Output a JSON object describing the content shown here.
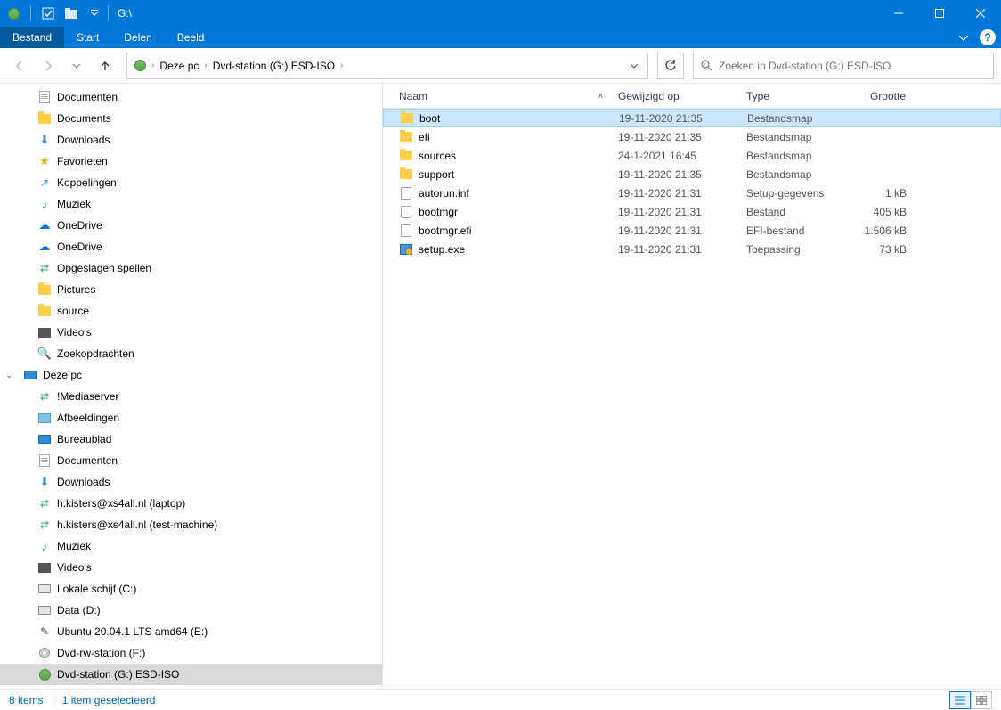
{
  "titlebar": {
    "title": "G:\\"
  },
  "ribbon": {
    "file": "Bestand",
    "tabs": [
      "Start",
      "Delen",
      "Beeld"
    ]
  },
  "breadcrumb": {
    "items": [
      "Deze pc",
      "Dvd-station (G:) ESD-ISO"
    ]
  },
  "search": {
    "placeholder": "Zoeken in Dvd-station (G:) ESD-ISO"
  },
  "columns": {
    "name": "Naam",
    "modified": "Gewijzigd op",
    "type": "Type",
    "size": "Grootte"
  },
  "nav_groups": [
    {
      "indent": 1,
      "icon": "doc",
      "label": "Documenten"
    },
    {
      "indent": 1,
      "icon": "folder",
      "label": "Documents"
    },
    {
      "indent": 1,
      "icon": "down",
      "label": "Downloads"
    },
    {
      "indent": 1,
      "icon": "star",
      "label": "Favorieten"
    },
    {
      "indent": 1,
      "icon": "link",
      "label": "Koppelingen"
    },
    {
      "indent": 1,
      "icon": "music",
      "label": "Muziek"
    },
    {
      "indent": 1,
      "icon": "cloud",
      "label": "OneDrive"
    },
    {
      "indent": 1,
      "icon": "cloud",
      "label": "OneDrive"
    },
    {
      "indent": 1,
      "icon": "net",
      "label": "Opgeslagen spellen"
    },
    {
      "indent": 1,
      "icon": "folder",
      "label": "Pictures"
    },
    {
      "indent": 1,
      "icon": "folder",
      "label": "source"
    },
    {
      "indent": 1,
      "icon": "vid",
      "label": "Video's"
    },
    {
      "indent": 1,
      "icon": "search",
      "label": "Zoekopdrachten"
    }
  ],
  "nav_thispc": {
    "root": "Deze pc",
    "items": [
      {
        "icon": "net",
        "label": "!Mediaserver"
      },
      {
        "icon": "pic",
        "label": "Afbeeldingen"
      },
      {
        "icon": "monitor",
        "label": "Bureaublad"
      },
      {
        "icon": "doc",
        "label": "Documenten"
      },
      {
        "icon": "down",
        "label": "Downloads"
      },
      {
        "icon": "net",
        "label": "h.kisters@xs4all.nl (laptop)"
      },
      {
        "icon": "net",
        "label": "h.kisters@xs4all.nl (test-machine)"
      },
      {
        "icon": "music",
        "label": "Muziek"
      },
      {
        "icon": "vid",
        "label": "Video's"
      },
      {
        "icon": "drive",
        "label": "Lokale schijf (C:)"
      },
      {
        "icon": "drive",
        "label": "Data (D:)"
      },
      {
        "icon": "usb",
        "label": "Ubuntu 20.04.1 LTS amd64 (E:)"
      },
      {
        "icon": "disc",
        "label": "Dvd-rw-station (F:)"
      },
      {
        "icon": "disc2",
        "label": "Dvd-station (G:) ESD-ISO",
        "selected": true
      }
    ]
  },
  "files": [
    {
      "icon": "folder",
      "name": "boot",
      "modified": "19-11-2020 21:35",
      "type": "Bestandsmap",
      "size": "",
      "selected": true
    },
    {
      "icon": "folder",
      "name": "efi",
      "modified": "19-11-2020 21:35",
      "type": "Bestandsmap",
      "size": ""
    },
    {
      "icon": "folder",
      "name": "sources",
      "modified": "24-1-2021 16:45",
      "type": "Bestandsmap",
      "size": ""
    },
    {
      "icon": "folder",
      "name": "support",
      "modified": "19-11-2020 21:35",
      "type": "Bestandsmap",
      "size": ""
    },
    {
      "icon": "file",
      "name": "autorun.inf",
      "modified": "19-11-2020 21:31",
      "type": "Setup-gegevens",
      "size": "1 kB"
    },
    {
      "icon": "file",
      "name": "bootmgr",
      "modified": "19-11-2020 21:31",
      "type": "Bestand",
      "size": "405 kB"
    },
    {
      "icon": "file",
      "name": "bootmgr.efi",
      "modified": "19-11-2020 21:31",
      "type": "EFI-bestand",
      "size": "1.506 kB"
    },
    {
      "icon": "exe",
      "name": "setup.exe",
      "modified": "19-11-2020 21:31",
      "type": "Toepassing",
      "size": "73 kB"
    }
  ],
  "status": {
    "items": "8 items",
    "selected": "1 item geselecteerd"
  }
}
